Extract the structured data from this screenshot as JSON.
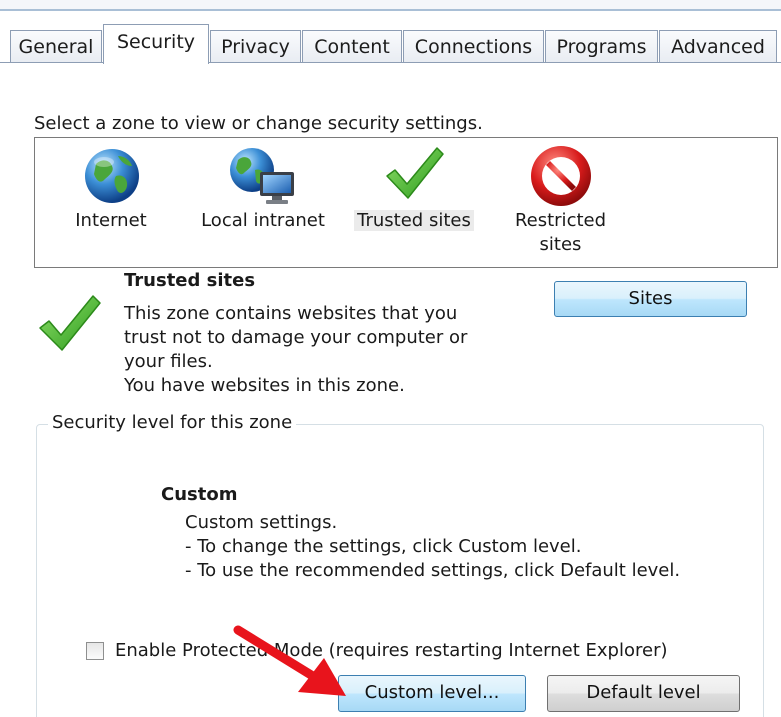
{
  "tabs": [
    "General",
    "Security",
    "Privacy",
    "Content",
    "Connections",
    "Programs",
    "Advanced"
  ],
  "active_tab": "Security",
  "zone_prompt": "Select a zone to view or change security settings.",
  "zones": {
    "internet": "Internet",
    "local_intranet": "Local intranet",
    "trusted_sites": "Trusted sites",
    "restricted_line1": "Restricted",
    "restricted_line2": "sites"
  },
  "selected_zone": {
    "title": "Trusted sites",
    "desc_line1": "This zone contains websites that you",
    "desc_line2": "trust not to damage your computer or",
    "desc_line3": "your files.",
    "desc_line4": "You have websites in this zone.",
    "sites_button": "Sites"
  },
  "security_level": {
    "group_label": "Security level for this zone",
    "title": "Custom",
    "line1": "Custom settings.",
    "line2": "- To change the settings, click Custom level.",
    "line3": "- To use the recommended settings, click Default level."
  },
  "protected_mode": {
    "label": "Enable Protected Mode (requires restarting Internet Explorer)",
    "checked": false
  },
  "buttons": {
    "custom_level": "Custom level...",
    "default_level": "Default level"
  },
  "colors": {
    "arrow": "#e8141c",
    "check_green": "#3fae2a",
    "tab_border": "#8d9db4"
  }
}
